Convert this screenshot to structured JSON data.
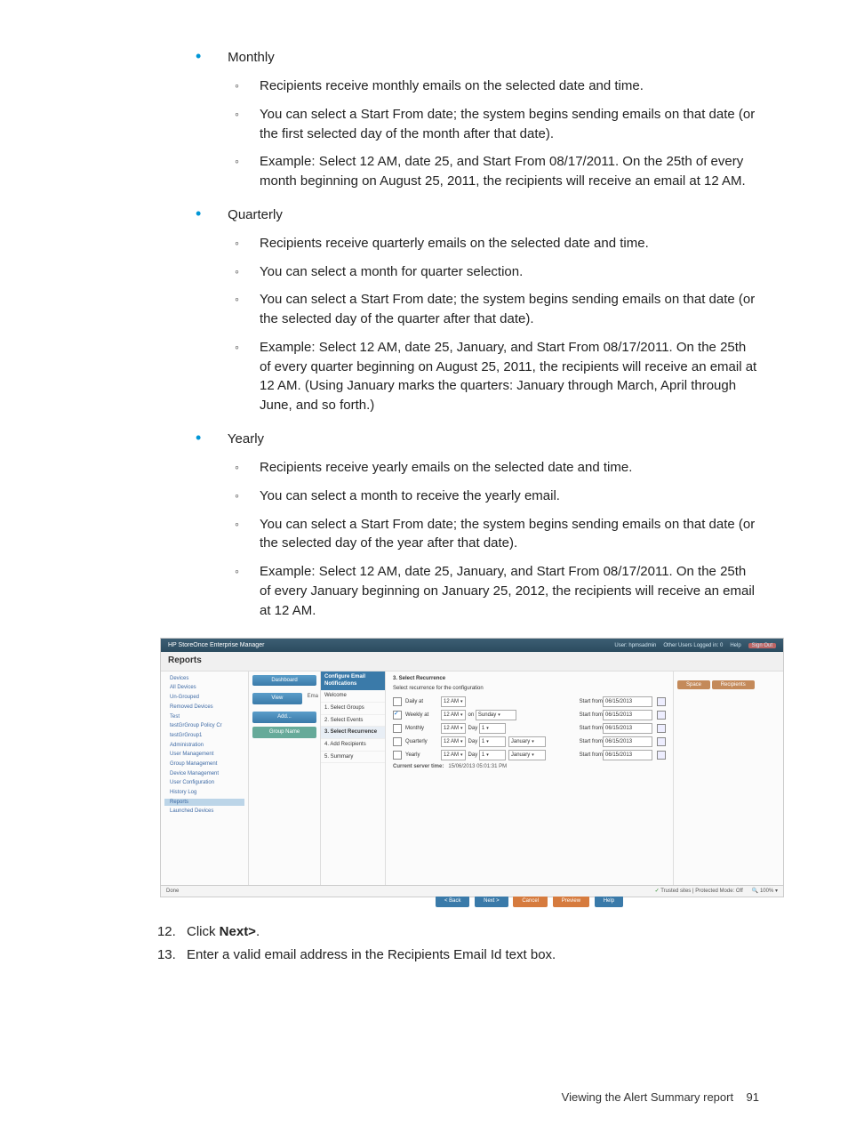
{
  "sections": [
    {
      "label": "Monthly",
      "items": [
        "Recipients receive monthly emails on the selected date and time.",
        "You can select a Start From date; the system begins sending emails on that date (or the first selected day of the month after that date).",
        "Example: Select 12 AM, date 25, and Start From 08/17/2011. On the 25th of every month beginning on August 25, 2011, the recipients will receive an email at 12 AM."
      ]
    },
    {
      "label": "Quarterly",
      "items": [
        "Recipients receive quarterly emails on the selected date and time.",
        "You can select a month for quarter selection.",
        "You can select a Start From date; the system begins sending emails on that date (or the selected day of the quarter after that date).",
        "Example: Select 12 AM, date 25, January, and Start From 08/17/2011. On the 25th of every quarter beginning on August 25, 2011, the recipients will receive an email at 12 AM. (Using January marks the quarters: January through March, April through June, and so forth.)"
      ]
    },
    {
      "label": "Yearly",
      "items": [
        "Recipients receive yearly emails on the selected date and time.",
        "You can select a month to receive the yearly email.",
        "You can select a Start From date; the system begins sending emails on that date (or the selected day of the year after that date).",
        "Example: Select 12 AM, date 25, January, and Start From 08/17/2011. On the 25th of every January beginning on January 25, 2012, the recipients will receive an email at 12 AM."
      ]
    }
  ],
  "screenshot": {
    "title": "HP StoreOnce Enterprise Manager",
    "header_right": {
      "user": "User: hpmsadmin",
      "other_logged": "Other Users Logged in: 0",
      "help": "Help",
      "signout": "Sign Out"
    },
    "subheader": "Reports",
    "leftnav": [
      "Devices",
      "All Devices",
      "Un-Grouped",
      "Removed Devices",
      "Test",
      "testGrGroup Policy Cr",
      "testGrGroup1",
      "Administration",
      "User Management",
      "Group Management",
      "Device Management",
      "User Configuration",
      "History Log",
      "Reports",
      "Launched Devices"
    ],
    "leftnav_selected_index": 13,
    "middle": {
      "dashboard_btn": "Dashboard",
      "view_btn": "View",
      "ema": "Ema",
      "add_btn": "Add...",
      "grp": "Group Name"
    },
    "wizard": {
      "title": "Configure Email Notifications",
      "welcome": "Welcome",
      "steps": [
        "1. Select Groups",
        "2. Select Events",
        "3. Select Recurrence",
        "4. Add Recipients",
        "5. Summary"
      ],
      "active_index": 2
    },
    "main": {
      "title": "3. Select Recurrence",
      "subtitle": "Select recurrence for the configuration",
      "rows": [
        {
          "checked": false,
          "label": "Daily at",
          "time": "12 AM",
          "extra": "",
          "start_from_label": "Start from",
          "start_from": "06/15/2013"
        },
        {
          "checked": true,
          "label": "Weekly at",
          "time": "12 AM",
          "on": "on",
          "select1": "Sunday",
          "start_from_label": "Start from",
          "start_from": "06/15/2013"
        },
        {
          "checked": false,
          "label": "Monthly",
          "time": "12 AM",
          "day_lbl": "Day",
          "day": "1",
          "start_from_label": "Start from",
          "start_from": "06/15/2013"
        },
        {
          "checked": false,
          "label": "Quarterly",
          "time": "12 AM",
          "day_lbl": "Day",
          "day": "1",
          "month": "January",
          "start_from_label": "Start from",
          "start_from": "06/15/2013"
        },
        {
          "checked": false,
          "label": "Yearly",
          "time": "12 AM",
          "day_lbl": "Day",
          "day": "1",
          "month": "January",
          "start_from_label": "Start from",
          "start_from": "06/15/2013"
        }
      ],
      "server_time_label": "Current server time:",
      "server_time": "15/06/2013 05:01:31 PM"
    },
    "buttons": [
      "< Back",
      "Next >",
      "Cancel",
      "Preview",
      "Help"
    ],
    "rightpanel": {
      "btn1": "Space",
      "btn2": "Recipients"
    },
    "statusbar": {
      "done": "Done",
      "trusted": "Trusted sites | Protected Mode: Off",
      "zoom": "100%"
    }
  },
  "steps_after": {
    "step12_prefix": "Click ",
    "step12_bold": "Next>",
    "step12_suffix": ".",
    "step13": "Enter a valid email address in the Recipients Email Id text box."
  },
  "footer": {
    "text": "Viewing the Alert Summary report",
    "page": "91"
  }
}
